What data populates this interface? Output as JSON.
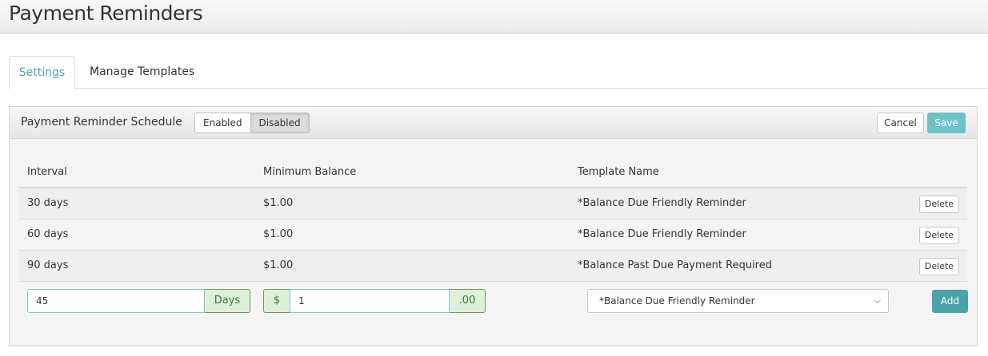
{
  "header": {
    "title": "Payment Reminders"
  },
  "tabs": [
    {
      "label": "Settings",
      "active": true
    },
    {
      "label": "Manage Templates",
      "active": false
    }
  ],
  "panel": {
    "title": "Payment Reminder Schedule",
    "toggle": {
      "enabled_label": "Enabled",
      "disabled_label": "Disabled",
      "selected": "Disabled"
    },
    "cancel_label": "Cancel",
    "save_label": "Save"
  },
  "table": {
    "columns": [
      "Interval",
      "Minimum Balance",
      "Template Name"
    ],
    "rows": [
      {
        "interval": "30 days",
        "min_balance": "$1.00",
        "template": "*Balance Due Friendly Reminder",
        "delete_label": "Delete"
      },
      {
        "interval": "60 days",
        "min_balance": "$1.00",
        "template": "*Balance Due Friendly Reminder",
        "delete_label": "Delete"
      },
      {
        "interval": "90 days",
        "min_balance": "$1.00",
        "template": "*Balance Past Due Payment Required",
        "delete_label": "Delete"
      }
    ],
    "new_row": {
      "interval_value": "45",
      "interval_addon": "Days",
      "balance_prefix": "$",
      "balance_value": "1",
      "balance_suffix": ".00",
      "template_selected": "*Balance Due Friendly Reminder",
      "add_label": "Add"
    }
  },
  "colors": {
    "accent": "#4aa3a8",
    "save": "#6cc3c6",
    "addon_bg": "#dff0d8",
    "addon_text": "#3c763d"
  }
}
